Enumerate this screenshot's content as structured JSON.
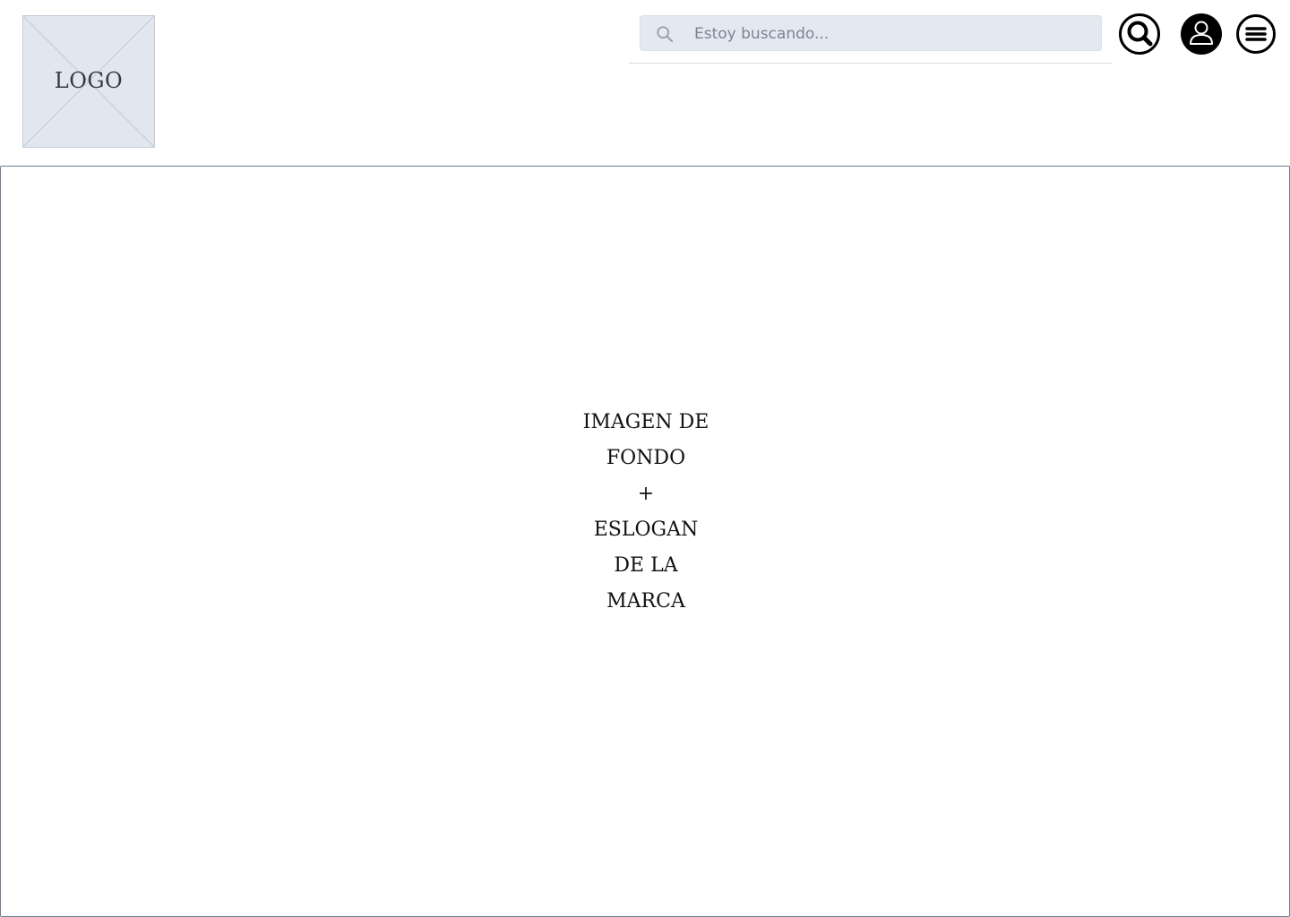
{
  "header": {
    "logo": {
      "label": "LOGO"
    },
    "search": {
      "placeholder": "Estoy buscando...",
      "value": "",
      "icon": "search-icon"
    },
    "actions": [
      {
        "name": "search-button",
        "icon": "search-icon"
      },
      {
        "name": "user-account-button",
        "icon": "user-icon"
      },
      {
        "name": "menu-button",
        "icon": "hamburger-menu-icon"
      }
    ]
  },
  "hero": {
    "lines": [
      "IMAGEN DE",
      "FONDO",
      "+",
      "ESLOGAN",
      "DE LA",
      "MARCA"
    ]
  },
  "colors": {
    "placeholder_fill": "#e2e7ef",
    "search_fill": "#e3e8f1",
    "hero_border": "#6d7f93",
    "icon": "#000000"
  }
}
